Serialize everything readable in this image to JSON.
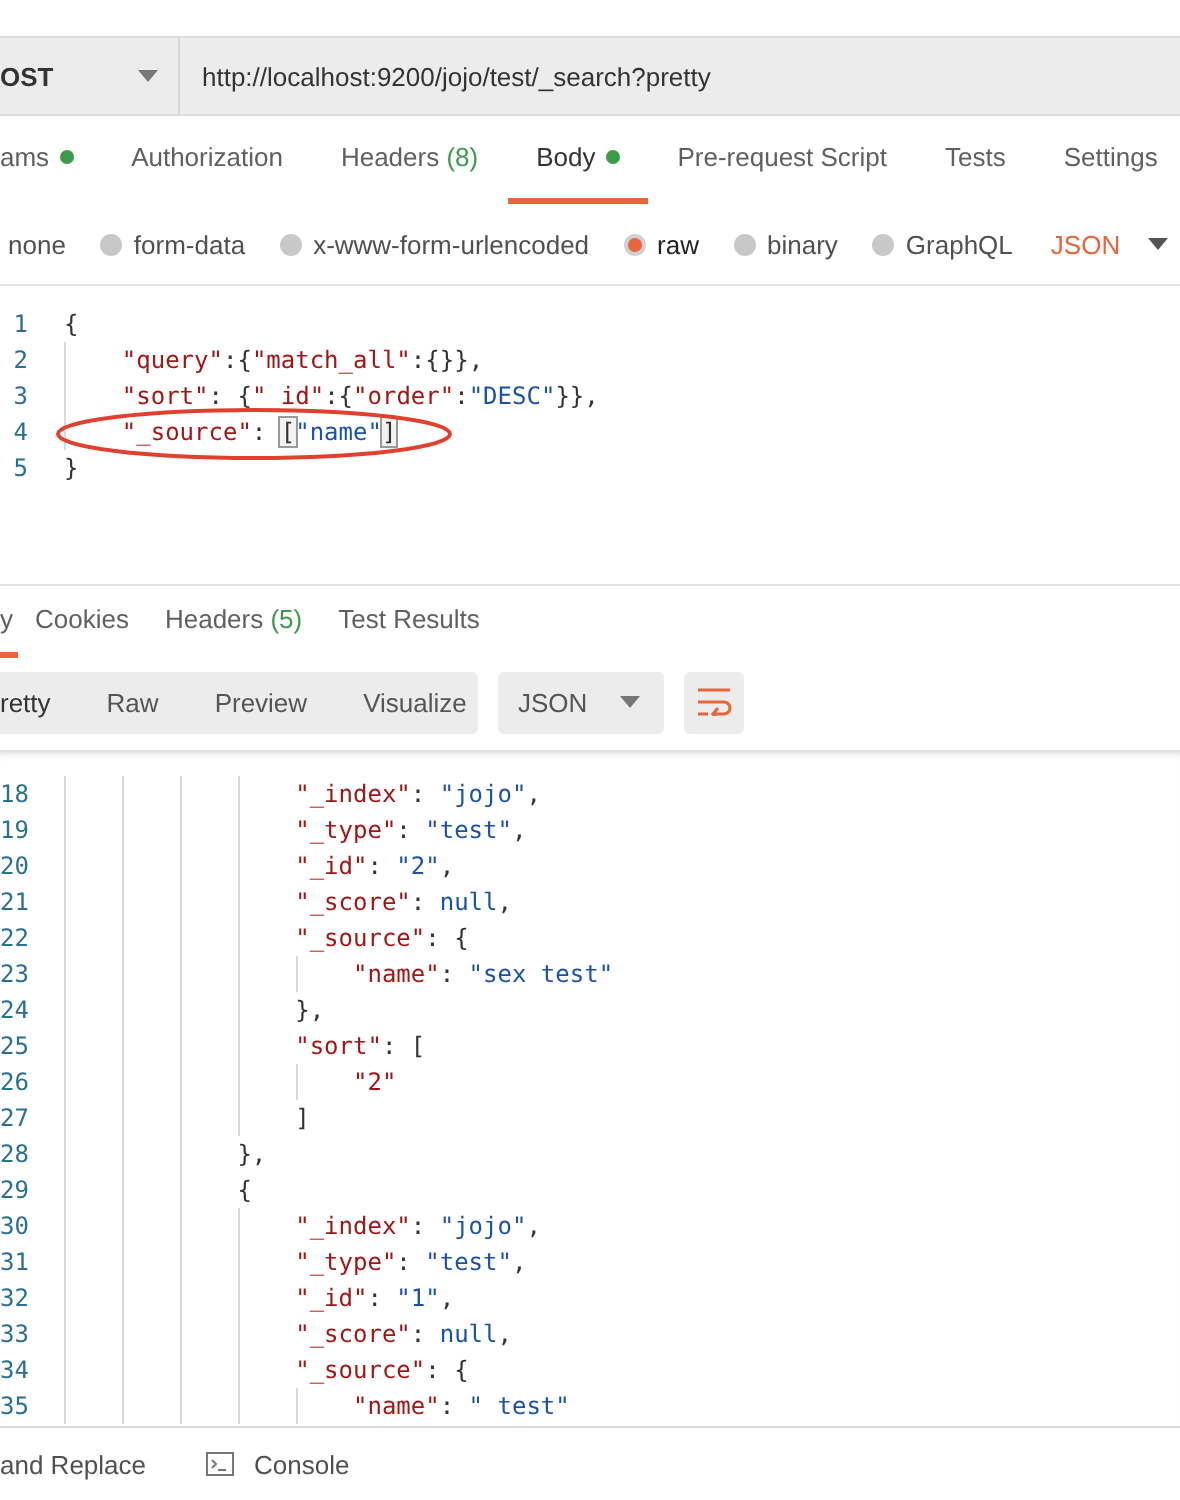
{
  "request_bar": {
    "method": "OST",
    "url": "http://localhost:9200/jojo/test/_search?pretty"
  },
  "request_tabs": [
    {
      "label": "ams",
      "dot": true,
      "selected": false
    },
    {
      "label": "Authorization",
      "dot": false,
      "selected": false
    },
    {
      "label": "Headers",
      "count": "(8)",
      "dot": false,
      "selected": false
    },
    {
      "label": "Body",
      "dot": true,
      "selected": true
    },
    {
      "label": "Pre-request Script",
      "dot": false,
      "selected": false
    },
    {
      "label": "Tests",
      "dot": false,
      "selected": false
    },
    {
      "label": "Settings",
      "dot": false,
      "selected": false
    }
  ],
  "body_types": [
    {
      "label": "none",
      "selected": false,
      "kind": "plain"
    },
    {
      "label": "form-data",
      "selected": false,
      "kind": "radio"
    },
    {
      "label": "x-www-form-urlencoded",
      "selected": false,
      "kind": "radio"
    },
    {
      "label": "raw",
      "selected": true,
      "kind": "radio"
    },
    {
      "label": "binary",
      "selected": false,
      "kind": "radio"
    },
    {
      "label": "GraphQL",
      "selected": false,
      "kind": "radio"
    }
  ],
  "body_format": "JSON",
  "request_editor": [
    {
      "number": "1",
      "tokens": [
        {
          "kind": "punct",
          "text": "{"
        }
      ]
    },
    {
      "number": "2",
      "tokens": [
        {
          "kind": "key",
          "text": "    \"query\""
        },
        {
          "kind": "punct",
          "text": ":{"
        },
        {
          "kind": "key",
          "text": "\"match_all\""
        },
        {
          "kind": "punct",
          "text": ":{}},"
        }
      ]
    },
    {
      "number": "3",
      "tokens": [
        {
          "kind": "key",
          "text": "    \"sort\""
        },
        {
          "kind": "punct",
          "text": ": {"
        },
        {
          "kind": "key",
          "text": "\"_id\""
        },
        {
          "kind": "punct",
          "text": ":{"
        },
        {
          "kind": "key",
          "text": "\"order\""
        },
        {
          "kind": "punct",
          "text": ":"
        },
        {
          "kind": "string",
          "text": "\"DESC\""
        },
        {
          "kind": "punct",
          "text": "}},"
        }
      ]
    },
    {
      "number": "4",
      "tokens": [
        {
          "kind": "key",
          "text": "    \"_source\""
        },
        {
          "kind": "punct",
          "text": ": "
        },
        {
          "kind": "bracket",
          "text": "["
        },
        {
          "kind": "string",
          "text": "\"name\""
        },
        {
          "kind": "bracket",
          "text": "]"
        }
      ]
    },
    {
      "number": "5",
      "tokens": [
        {
          "kind": "punct",
          "text": "}"
        }
      ]
    }
  ],
  "response_tabs": [
    {
      "label": "y",
      "selected": true
    },
    {
      "label": "Cookies",
      "selected": false
    },
    {
      "label": "Headers",
      "count": "(5)",
      "selected": false
    },
    {
      "label": "Test Results",
      "selected": false
    }
  ],
  "view_modes": [
    {
      "label": "retty",
      "selected": true
    },
    {
      "label": "Raw",
      "selected": false
    },
    {
      "label": "Preview",
      "selected": false
    },
    {
      "label": "Visualize",
      "selected": false
    }
  ],
  "response_format": "JSON",
  "response_body": [
    {
      "number": "18",
      "tokens": [
        {
          "kind": "key",
          "text": "                \"_index\""
        },
        {
          "kind": "punct",
          "text": ": "
        },
        {
          "kind": "string",
          "text": "\"jojo\""
        },
        {
          "kind": "punct",
          "text": ","
        }
      ]
    },
    {
      "number": "19",
      "tokens": [
        {
          "kind": "key",
          "text": "                \"_type\""
        },
        {
          "kind": "punct",
          "text": ": "
        },
        {
          "kind": "string",
          "text": "\"test\""
        },
        {
          "kind": "punct",
          "text": ","
        }
      ]
    },
    {
      "number": "20",
      "tokens": [
        {
          "kind": "key",
          "text": "                \"_id\""
        },
        {
          "kind": "punct",
          "text": ": "
        },
        {
          "kind": "string",
          "text": "\"2\""
        },
        {
          "kind": "punct",
          "text": ","
        }
      ]
    },
    {
      "number": "21",
      "tokens": [
        {
          "kind": "key",
          "text": "                \"_score\""
        },
        {
          "kind": "punct",
          "text": ": "
        },
        {
          "kind": "string",
          "text": "null"
        },
        {
          "kind": "punct",
          "text": ","
        }
      ]
    },
    {
      "number": "22",
      "tokens": [
        {
          "kind": "key",
          "text": "                \"_source\""
        },
        {
          "kind": "punct",
          "text": ": {"
        }
      ]
    },
    {
      "number": "23",
      "tokens": [
        {
          "kind": "key",
          "text": "                    \"name\""
        },
        {
          "kind": "punct",
          "text": ": "
        },
        {
          "kind": "string",
          "text": "\"sex test\""
        }
      ]
    },
    {
      "number": "24",
      "tokens": [
        {
          "kind": "punct",
          "text": "                },"
        }
      ]
    },
    {
      "number": "25",
      "tokens": [
        {
          "kind": "key",
          "text": "                \"sort\""
        },
        {
          "kind": "punct",
          "text": ": ["
        }
      ]
    },
    {
      "number": "26",
      "tokens": [
        {
          "kind": "key",
          "text": "                    \"2\""
        }
      ]
    },
    {
      "number": "27",
      "tokens": [
        {
          "kind": "punct",
          "text": "                ]"
        }
      ]
    },
    {
      "number": "28",
      "tokens": [
        {
          "kind": "punct",
          "text": "            },"
        }
      ]
    },
    {
      "number": "29",
      "tokens": [
        {
          "kind": "punct",
          "text": "            {"
        }
      ]
    },
    {
      "number": "30",
      "tokens": [
        {
          "kind": "key",
          "text": "                \"_index\""
        },
        {
          "kind": "punct",
          "text": ": "
        },
        {
          "kind": "string",
          "text": "\"jojo\""
        },
        {
          "kind": "punct",
          "text": ","
        }
      ]
    },
    {
      "number": "31",
      "tokens": [
        {
          "kind": "key",
          "text": "                \"_type\""
        },
        {
          "kind": "punct",
          "text": ": "
        },
        {
          "kind": "string",
          "text": "\"test\""
        },
        {
          "kind": "punct",
          "text": ","
        }
      ]
    },
    {
      "number": "32",
      "tokens": [
        {
          "kind": "key",
          "text": "                \"_id\""
        },
        {
          "kind": "punct",
          "text": ": "
        },
        {
          "kind": "string",
          "text": "\"1\""
        },
        {
          "kind": "punct",
          "text": ","
        }
      ]
    },
    {
      "number": "33",
      "tokens": [
        {
          "kind": "key",
          "text": "                \"_score\""
        },
        {
          "kind": "punct",
          "text": ": "
        },
        {
          "kind": "string",
          "text": "null"
        },
        {
          "kind": "punct",
          "text": ","
        }
      ]
    },
    {
      "number": "34",
      "tokens": [
        {
          "kind": "key",
          "text": "                \"_source\""
        },
        {
          "kind": "punct",
          "text": ": {"
        }
      ]
    },
    {
      "number": "35",
      "tokens": [
        {
          "kind": "key",
          "text": "                    \"name\""
        },
        {
          "kind": "punct",
          "text": ": "
        },
        {
          "kind": "string",
          "text": "\" test\""
        }
      ]
    }
  ],
  "footer": [
    {
      "kind": "text",
      "label": "and Replace"
    },
    {
      "kind": "console",
      "label": "Console"
    }
  ]
}
